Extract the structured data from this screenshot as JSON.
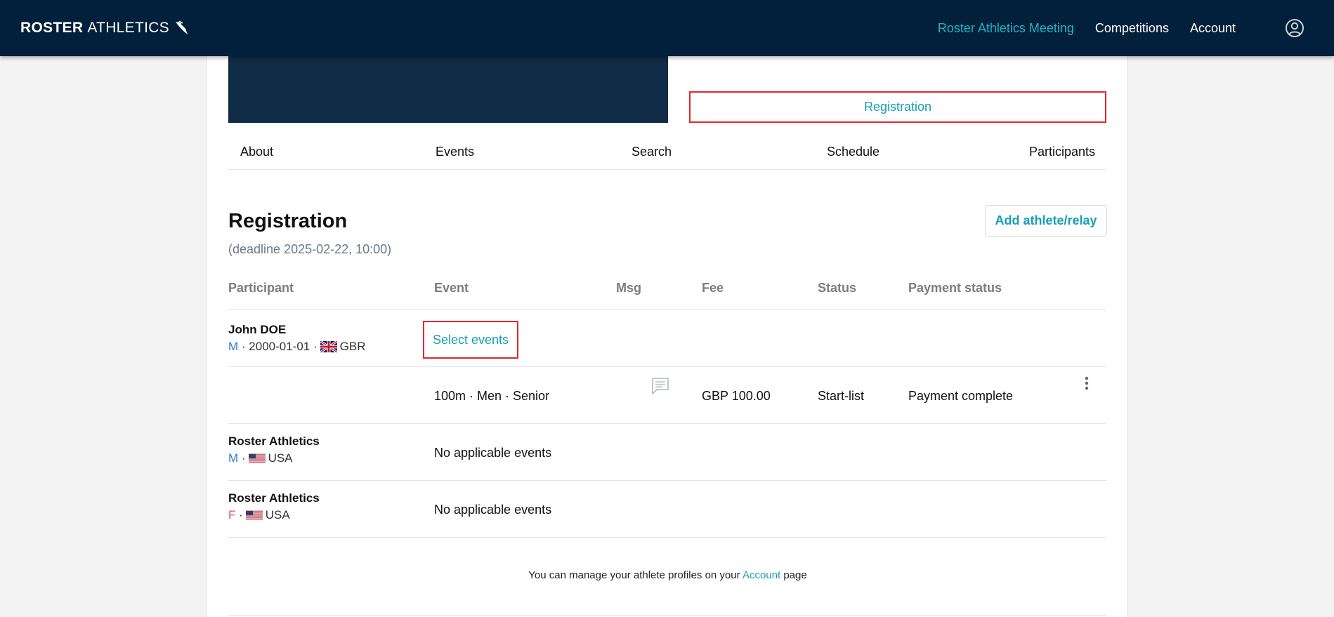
{
  "navbar": {
    "brand_bold": "ROSTER",
    "brand_light": "ATHLETICS",
    "links": [
      "Roster Athletics Meeting",
      "Competitions",
      "Account"
    ]
  },
  "competition": {
    "registration_button": "Registration",
    "tabs": [
      "About",
      "Events",
      "Search",
      "Schedule",
      "Participants"
    ]
  },
  "registration": {
    "title": "Registration",
    "deadline": "(deadline 2025-02-22, 10:00)",
    "add_button": "Add athlete/relay",
    "columns": [
      "Participant",
      "Event",
      "Msg",
      "Fee",
      "Status",
      "Payment status"
    ],
    "participants": [
      {
        "name": "John DOE",
        "sex": "M",
        "dob": "2000-01-01",
        "country": "GBR",
        "select_events_label": "Select events",
        "entry": {
          "event": "100m · Men · Senior",
          "fee": "GBP 100.00",
          "status": "Start-list",
          "payment_status": "Payment complete"
        }
      },
      {
        "name": "Roster Athletics",
        "sex": "M",
        "country": "USA",
        "event_text": "No applicable events"
      },
      {
        "name": "Roster Athletics",
        "sex": "F",
        "country": "USA",
        "event_text": "No applicable events"
      }
    ],
    "footer_prefix": "You can manage your athlete profiles on your",
    "footer_link": "Account",
    "footer_suffix": "page"
  },
  "icons": [
    "wing-icon",
    "user-circle-icon",
    "uk-flag-icon",
    "us-flag-icon",
    "message-icon",
    "kebab-menu-icon"
  ],
  "colors": {
    "navbar": "#02203b",
    "accent": "#179fb4",
    "active_nav": "#1fb5c7",
    "highlight_border": "#e3262e",
    "banner": "#102b46"
  }
}
